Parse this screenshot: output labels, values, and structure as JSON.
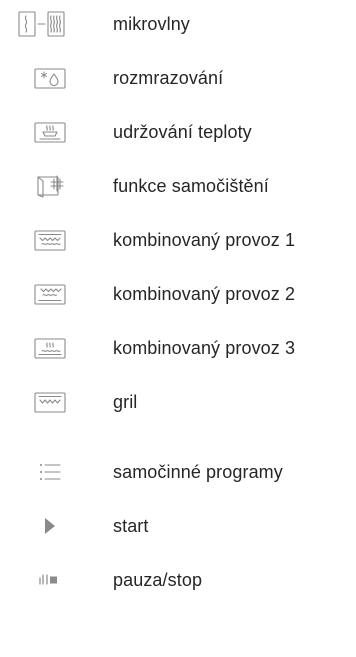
{
  "legend": {
    "items": [
      {
        "icon": "microwave-power-icon",
        "label": "mikrovlny"
      },
      {
        "icon": "defrost-icon",
        "label": "rozmrazování"
      },
      {
        "icon": "keep-warm-icon",
        "label": "udržování teploty"
      },
      {
        "icon": "self-cleaning-icon",
        "label": "funkce samočištění"
      },
      {
        "icon": "combi-mode-1-icon",
        "label": "kombinovaný provoz 1"
      },
      {
        "icon": "combi-mode-2-icon",
        "label": "kombinovaný provoz 2"
      },
      {
        "icon": "combi-mode-3-icon",
        "label": "kombinovaný provoz 3"
      },
      {
        "icon": "grill-icon",
        "label": "gril"
      },
      {
        "icon": "auto-programs-icon",
        "label": "samočinné programy"
      },
      {
        "icon": "start-icon",
        "label": "start"
      },
      {
        "icon": "pause-stop-icon",
        "label": "pauza/stop"
      }
    ]
  },
  "colors": {
    "icon_stroke": "#8a8a8a",
    "text": "#262626"
  }
}
